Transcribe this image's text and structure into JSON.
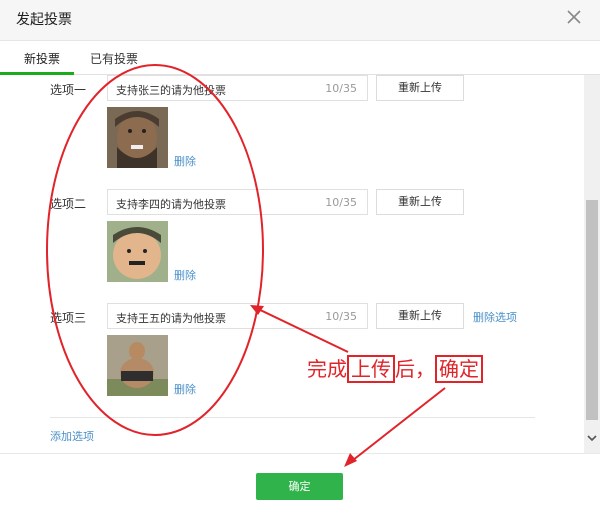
{
  "dialog": {
    "title": "发起投票"
  },
  "tabs": [
    {
      "label": "新投票"
    },
    {
      "label": "已有投票"
    }
  ],
  "options": [
    {
      "label": "选项一",
      "text": "支持张三的请为他投票",
      "count": "10/35",
      "reupload": "重新上传",
      "delete_image": "删除"
    },
    {
      "label": "选项二",
      "text": "支持李四的请为他投票",
      "count": "10/35",
      "reupload": "重新上传",
      "delete_image": "删除"
    },
    {
      "label": "选项三",
      "text": "支持王五的请为他投票",
      "count": "10/35",
      "reupload": "重新上传",
      "delete_image": "删除",
      "delete_option": "删除选项"
    }
  ],
  "add_option": "添加选项",
  "footer": {
    "ok": "确定"
  },
  "annotation": {
    "part1": "完成",
    "part2": "上传",
    "part3": "后，",
    "part4": "确定"
  },
  "colors": {
    "accent_green": "#2fb34a",
    "link_blue": "#4a90c8",
    "annotation_red": "#e0242a"
  },
  "icons": [
    "close-icon",
    "scroll-down-icon"
  ]
}
